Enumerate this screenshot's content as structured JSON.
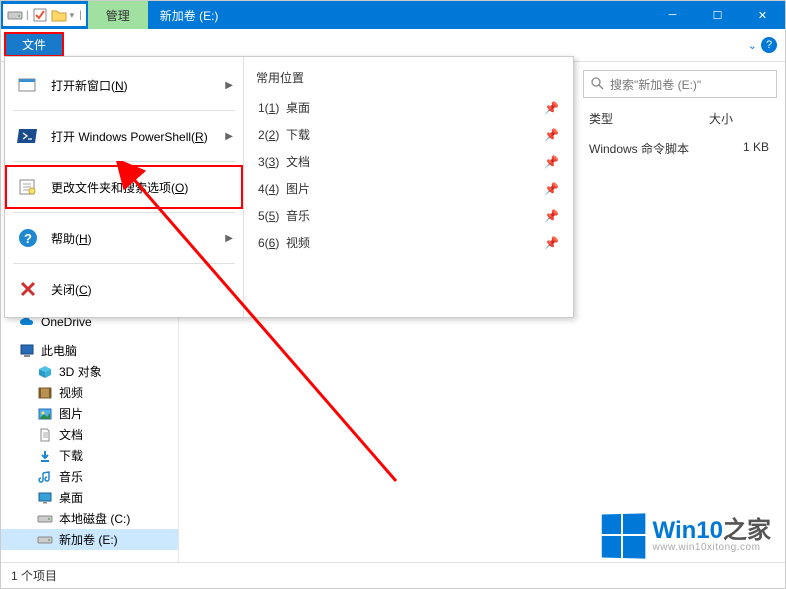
{
  "titlebar": {
    "ribbon_context_tab": "管理",
    "window_title": "新加卷 (E:)"
  },
  "file_menu": {
    "button_label": "文件",
    "left_items": [
      {
        "label": "打开新窗口(N)",
        "has_submenu": true,
        "icon": "new-window"
      },
      {
        "label": "打开 Windows PowerShell(R)",
        "has_submenu": true,
        "icon": "powershell"
      },
      {
        "label": "更改文件夹和搜索选项(O)",
        "has_submenu": false,
        "icon": "options",
        "highlighted": true
      },
      {
        "label": "帮助(H)",
        "has_submenu": true,
        "icon": "help"
      },
      {
        "label": "关闭(C)",
        "has_submenu": false,
        "icon": "close"
      }
    ],
    "right_panel": {
      "header": "常用位置",
      "items": [
        {
          "index": "1(1)",
          "label": "桌面"
        },
        {
          "index": "2(2)",
          "label": "下载"
        },
        {
          "index": "3(3)",
          "label": "文档"
        },
        {
          "index": "4(4)",
          "label": "图片"
        },
        {
          "index": "5(5)",
          "label": "音乐"
        },
        {
          "index": "6(6)",
          "label": "视频"
        }
      ]
    }
  },
  "nav_tree": {
    "onedrive": "OneDrive",
    "this_pc": "此电脑",
    "children": [
      {
        "label": "3D 对象",
        "icon": "3d"
      },
      {
        "label": "视频",
        "icon": "video"
      },
      {
        "label": "图片",
        "icon": "pictures"
      },
      {
        "label": "文档",
        "icon": "documents"
      },
      {
        "label": "下载",
        "icon": "downloads"
      },
      {
        "label": "音乐",
        "icon": "music"
      },
      {
        "label": "桌面",
        "icon": "desktop"
      },
      {
        "label": "本地磁盘 (C:)",
        "icon": "drive"
      },
      {
        "label": "新加卷 (E:)",
        "icon": "drive",
        "selected": true
      }
    ]
  },
  "search": {
    "placeholder": "搜索\"新加卷 (E:)\""
  },
  "columns": {
    "type": "类型",
    "size": "大小"
  },
  "files": [
    {
      "type": "Windows 命令脚本",
      "size": "1 KB"
    }
  ],
  "statusbar": {
    "item_count": "1 个项目"
  },
  "watermark": {
    "brand_prefix": "Win10",
    "brand_suffix": "之家",
    "url": "www.win10xitong.com"
  }
}
